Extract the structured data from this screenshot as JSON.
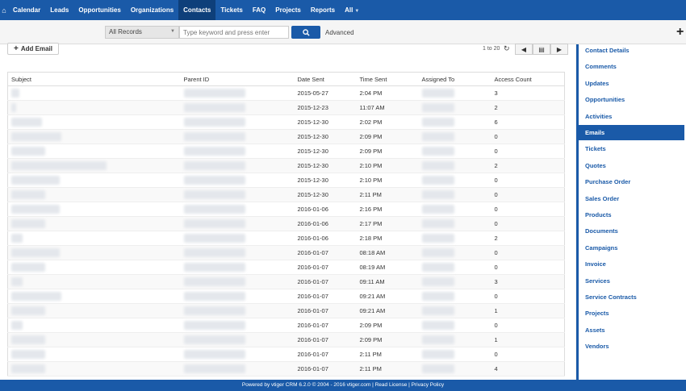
{
  "nav": {
    "items": [
      {
        "label": "Calendar"
      },
      {
        "label": "Leads"
      },
      {
        "label": "Opportunities"
      },
      {
        "label": "Organizations"
      },
      {
        "label": "Contacts"
      },
      {
        "label": "Tickets"
      },
      {
        "label": "FAQ"
      },
      {
        "label": "Projects"
      },
      {
        "label": "Reports"
      },
      {
        "label": "All"
      }
    ],
    "active": "Contacts"
  },
  "search": {
    "filter_value": "All Records",
    "placeholder": "Type keyword and press enter",
    "advanced_label": "Advanced"
  },
  "toolbar": {
    "add_email_label": "Add Email",
    "pager_text": "1 to 20"
  },
  "table": {
    "headers": [
      "Subject",
      "Parent ID",
      "Date Sent",
      "Time Sent",
      "Assigned To",
      "Access Count"
    ],
    "rows": [
      {
        "date": "2015-05-27",
        "time": "2:04 PM",
        "count": "3"
      },
      {
        "date": "2015-12-23",
        "time": "11:07 AM",
        "count": "2"
      },
      {
        "date": "2015-12-30",
        "time": "2:02 PM",
        "count": "6"
      },
      {
        "date": "2015-12-30",
        "time": "2:09 PM",
        "count": "0"
      },
      {
        "date": "2015-12-30",
        "time": "2:09 PM",
        "count": "0"
      },
      {
        "date": "2015-12-30",
        "time": "2:10 PM",
        "count": "2"
      },
      {
        "date": "2015-12-30",
        "time": "2:10 PM",
        "count": "0"
      },
      {
        "date": "2015-12-30",
        "time": "2:11 PM",
        "count": "0"
      },
      {
        "date": "2016-01-06",
        "time": "2:16 PM",
        "count": "0"
      },
      {
        "date": "2016-01-06",
        "time": "2:17 PM",
        "count": "0"
      },
      {
        "date": "2016-01-06",
        "time": "2:18 PM",
        "count": "2"
      },
      {
        "date": "2016-01-07",
        "time": "08:18 AM",
        "count": "0"
      },
      {
        "date": "2016-01-07",
        "time": "08:19 AM",
        "count": "0"
      },
      {
        "date": "2016-01-07",
        "time": "09:11 AM",
        "count": "3"
      },
      {
        "date": "2016-01-07",
        "time": "09:21 AM",
        "count": "0"
      },
      {
        "date": "2016-01-07",
        "time": "09:21 AM",
        "count": "1"
      },
      {
        "date": "2016-01-07",
        "time": "2:09 PM",
        "count": "0"
      },
      {
        "date": "2016-01-07",
        "time": "2:09 PM",
        "count": "1"
      },
      {
        "date": "2016-01-07",
        "time": "2:11 PM",
        "count": "0"
      },
      {
        "date": "2016-01-07",
        "time": "2:11 PM",
        "count": "4"
      }
    ]
  },
  "sidebar": {
    "items": [
      {
        "label": "Contact Details"
      },
      {
        "label": "Comments"
      },
      {
        "label": "Updates"
      },
      {
        "label": "Opportunities"
      },
      {
        "label": "Activities"
      },
      {
        "label": "Emails"
      },
      {
        "label": "Tickets"
      },
      {
        "label": "Quotes"
      },
      {
        "label": "Purchase Order"
      },
      {
        "label": "Sales Order"
      },
      {
        "label": "Products"
      },
      {
        "label": "Documents"
      },
      {
        "label": "Campaigns"
      },
      {
        "label": "Invoice"
      },
      {
        "label": "Services"
      },
      {
        "label": "Service Contracts"
      },
      {
        "label": "Projects"
      },
      {
        "label": "Assets"
      },
      {
        "label": "Vendors"
      }
    ],
    "active": "Emails"
  },
  "footer": {
    "text": "Powered by vtiger CRM 6.2.0  © 2004 - 2016  vtiger.com | Read License | Privacy Policy"
  },
  "colors": {
    "brand": "#1a5aa8",
    "brand_dark": "#0e3f7a"
  },
  "icons": {
    "home": "home-icon",
    "search": "search-icon",
    "refresh": "refresh-icon",
    "add": "plus-icon"
  }
}
